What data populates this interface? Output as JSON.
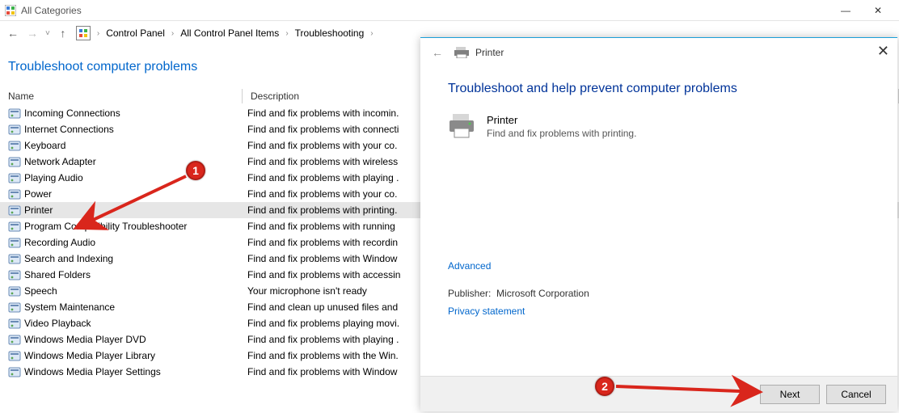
{
  "window": {
    "title": "All Categories",
    "controls": {
      "minimize": "—",
      "close": "✕"
    }
  },
  "breadcrumbs": {
    "items": [
      "Control Panel",
      "All Control Panel Items",
      "Troubleshooting"
    ]
  },
  "heading": "Troubleshoot computer problems",
  "columns": {
    "name": "Name",
    "description": "Description"
  },
  "items": [
    {
      "name": "Incoming Connections",
      "desc": "Find and fix problems with incomin."
    },
    {
      "name": "Internet Connections",
      "desc": "Find and fix problems with connecti"
    },
    {
      "name": "Keyboard",
      "desc": "Find and fix problems with your co."
    },
    {
      "name": "Network Adapter",
      "desc": "Find and fix problems with wireless"
    },
    {
      "name": "Playing Audio",
      "desc": "Find and fix problems with playing ."
    },
    {
      "name": "Power",
      "desc": "Find and fix problems with your co."
    },
    {
      "name": "Printer",
      "desc": "Find and fix problems with printing.",
      "selected": true
    },
    {
      "name": "Program Compatibility Troubleshooter",
      "desc": "Find and fix problems with running"
    },
    {
      "name": "Recording Audio",
      "desc": "Find and fix problems with recordin"
    },
    {
      "name": "Search and Indexing",
      "desc": "Find and fix problems with Window"
    },
    {
      "name": "Shared Folders",
      "desc": "Find and fix problems with accessin"
    },
    {
      "name": "Speech",
      "desc": "Your microphone isn't ready"
    },
    {
      "name": "System Maintenance",
      "desc": "Find and clean up unused files and"
    },
    {
      "name": "Video Playback",
      "desc": "Find and fix problems playing movi."
    },
    {
      "name": "Windows Media Player DVD",
      "desc": "Find and fix problems with playing ."
    },
    {
      "name": "Windows Media Player Library",
      "desc": "Find and fix problems with the Win."
    },
    {
      "name": "Windows Media Player Settings",
      "desc": "Find and fix problems with Window"
    }
  ],
  "dialog": {
    "title": "Printer",
    "heading": "Troubleshoot and help prevent computer problems",
    "item_title": "Printer",
    "item_sub": "Find and fix problems with printing.",
    "advanced": "Advanced",
    "publisher_label": "Publisher:",
    "publisher_value": "Microsoft Corporation",
    "privacy": "Privacy statement",
    "next": "Next",
    "cancel": "Cancel"
  },
  "annotations": {
    "b1": "1",
    "b2": "2"
  }
}
